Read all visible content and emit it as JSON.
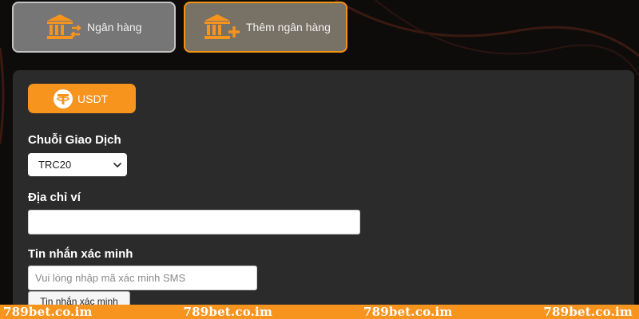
{
  "bank_tabs": {
    "bank_label": "Ngân hàng",
    "add_bank_label": "Thêm ngân hàng"
  },
  "currency": {
    "label": "USDT"
  },
  "form": {
    "chain_label": "Chuỗi Giao Dịch",
    "chain_value": "TRC20",
    "wallet_label": "Địa chỉ ví",
    "wallet_value": "",
    "sms_label": "Tin nhắn xác minh",
    "sms_placeholder": "Vui lòng nhập mã xác minh SMS",
    "sms_button_label": "Tin nhắn xác minh"
  },
  "watermark": {
    "items": [
      "789bet.co.im",
      "789bet.co.im",
      "789bet.co.im",
      "789bet.co.im"
    ]
  },
  "colors": {
    "accent": "#f7941e",
    "panel": "#2b2b2b",
    "background": "#0d0c0b"
  },
  "icons": {
    "bank_transfer": "bank-transfer-icon",
    "bank_add": "bank-add-icon",
    "usdt": "tether-icon",
    "chevron": "chevron-down-icon"
  }
}
